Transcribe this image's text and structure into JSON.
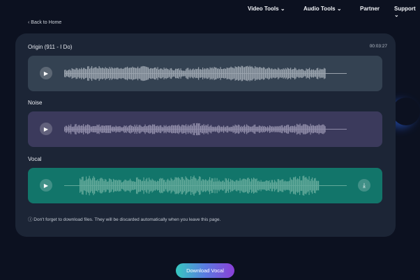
{
  "nav": {
    "items": [
      {
        "label": "Video Tools",
        "dropdown": true
      },
      {
        "label": "Audio Tools",
        "dropdown": true
      },
      {
        "label": "Partner",
        "dropdown": false
      },
      {
        "label": "Support",
        "dropdown": true
      }
    ]
  },
  "back_label": "‹ Back to Home",
  "tracks": [
    {
      "label": "Origin (911 - I Do)",
      "duration": "00:03:27",
      "bg": "#344252",
      "wave": "#9aa3ad"
    },
    {
      "label": "Noise",
      "bg": "#3b3a5c",
      "wave": "#8f8ca8"
    },
    {
      "label": "Vocal",
      "bg": "#12756a",
      "wave": "#62a99a"
    }
  ],
  "note": "ⓘ Don't forget to download files. They will be discarded automatically when you leave this page.",
  "download_button": "Download Vocal"
}
